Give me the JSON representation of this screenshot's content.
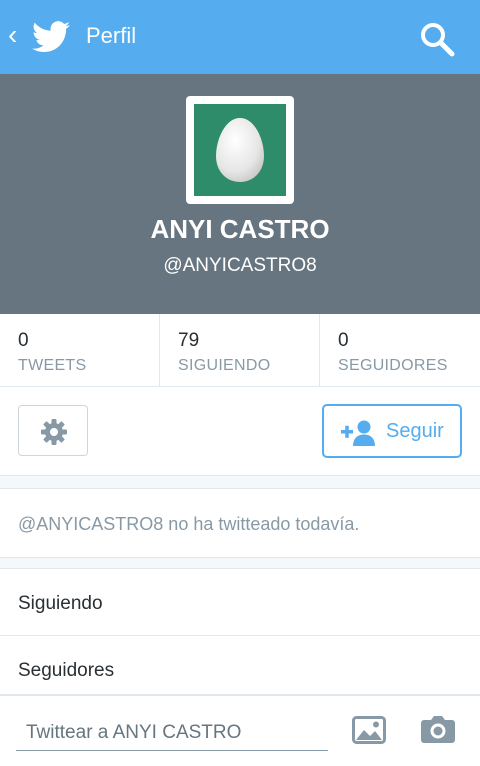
{
  "topbar": {
    "back_glyph": "‹",
    "title": "Perfil",
    "icons": {
      "logo": "twitter-bird-icon",
      "search": "search-icon"
    },
    "background": "#55acee"
  },
  "profile": {
    "name": "ANYI CASTRO",
    "handle": "@ANYICASTRO8",
    "avatar": "egg-avatar",
    "background": "#66757f",
    "avatar_background": "#2f8c6a"
  },
  "stats": [
    {
      "value": "0",
      "label": "TWEETS"
    },
    {
      "value": "79",
      "label": "SIGUIENDO"
    },
    {
      "value": "0",
      "label": "SEGUIDORES"
    }
  ],
  "actions": {
    "settings_icon": "gear-icon",
    "follow_icon": "add-user-icon",
    "follow_label": "Seguir",
    "accent": "#55acee"
  },
  "timeline": {
    "empty_message": "@ANYICASTRO8 no ha twitteado todavía."
  },
  "list": [
    {
      "label": "Siguiendo"
    },
    {
      "label": "Seguidores"
    }
  ],
  "compose": {
    "placeholder": "Twittear a ANYI CASTRO",
    "icons": {
      "image": "image-icon",
      "camera": "camera-icon"
    }
  }
}
